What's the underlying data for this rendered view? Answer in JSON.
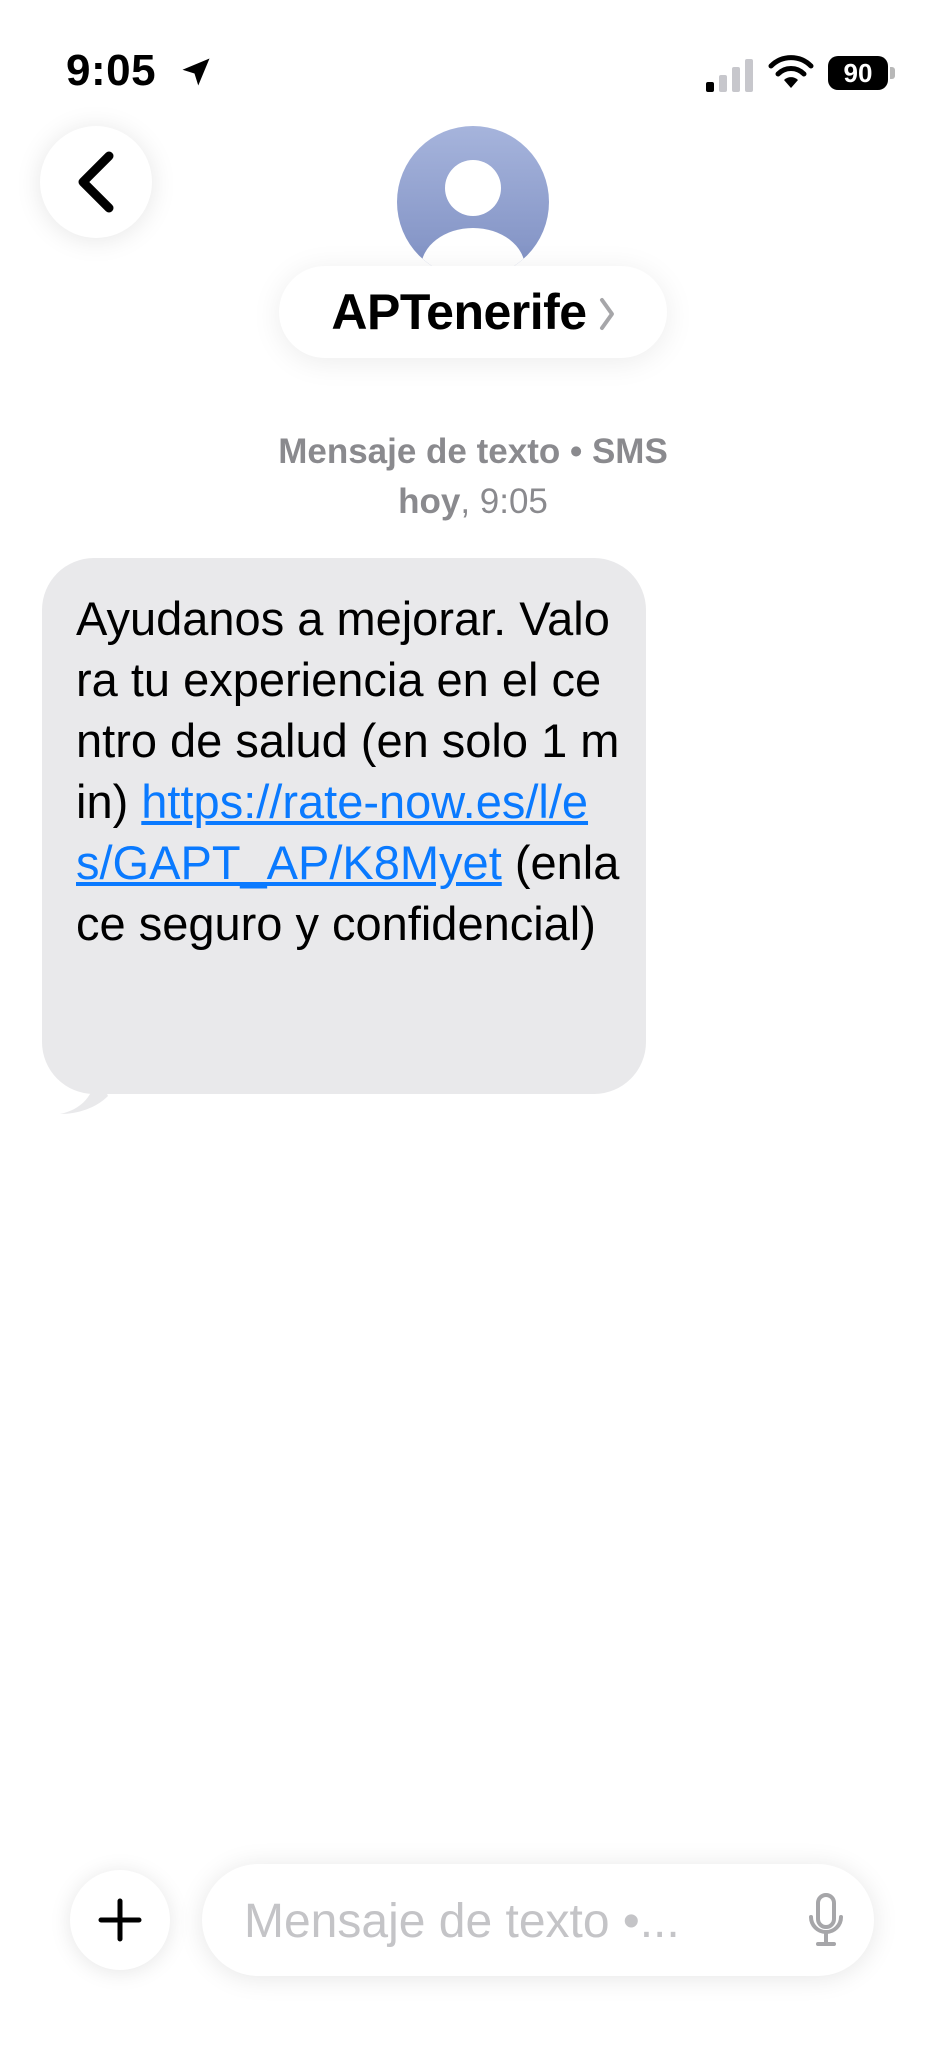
{
  "status_bar": {
    "time": "9:05",
    "battery": "90"
  },
  "header": {
    "contact_name": "APTenerife"
  },
  "conversation": {
    "message_type": "Mensaje de texto • SMS",
    "day": "hoy",
    "time": ", 9:05",
    "messages": [
      {
        "text_before": "Ayudanos a mejorar. Valora tu experiencia en el centro de salud (en solo 1 min) ",
        "link": "https://rate-now.es/l/es/GAPT_AP/K8Myet",
        "text_after": " (enlace seguro y confidencial)"
      }
    ]
  },
  "input_bar": {
    "placeholder": "Mensaje de texto •..."
  },
  "colors": {
    "bubble": "#e9e9eb",
    "link": "#0a7aff",
    "meta_text": "#8a8a8e"
  }
}
